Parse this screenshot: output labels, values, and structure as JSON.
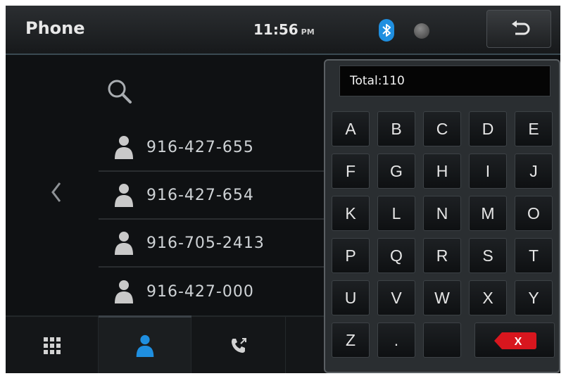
{
  "header": {
    "title": "Phone",
    "time": "11:56",
    "ampm": "PM"
  },
  "icons": {
    "bluetooth": "bluetooth-icon",
    "status": "status-dot-icon",
    "back": "back-icon",
    "search": "search-icon",
    "person": "person-icon",
    "left_arrow": "chevron-left-icon",
    "dialpad": "dialpad-icon",
    "call_log": "call-log-icon",
    "delete": "delete-icon"
  },
  "colors": {
    "accent": "#1f8fe0",
    "delete": "#d8161e"
  },
  "contacts": [
    {
      "number": "916-427-655"
    },
    {
      "number": "916-427-654"
    },
    {
      "number": "916-705-2413"
    },
    {
      "number": "916-427-000"
    }
  ],
  "keyboard": {
    "total": "Total:110",
    "rows": [
      [
        "A",
        "B",
        "C",
        "D",
        "E"
      ],
      [
        "F",
        "G",
        "H",
        "I",
        "J"
      ],
      [
        "K",
        "L",
        "N",
        "M",
        "O"
      ],
      [
        "P",
        "Q",
        "R",
        "S",
        "T"
      ],
      [
        "U",
        "V",
        "W",
        "X",
        "Y"
      ],
      [
        "Z",
        ".",
        ""
      ]
    ],
    "delete_label": "X"
  }
}
